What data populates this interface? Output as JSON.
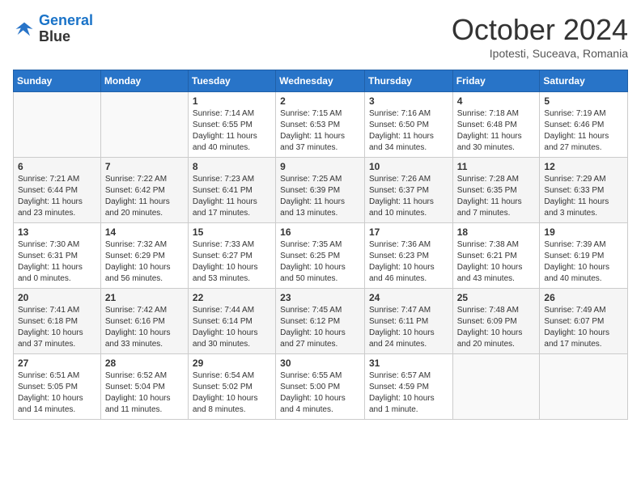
{
  "header": {
    "logo_line1": "General",
    "logo_line2": "Blue",
    "month": "October 2024",
    "location": "Ipotesti, Suceava, Romania"
  },
  "days_of_week": [
    "Sunday",
    "Monday",
    "Tuesday",
    "Wednesday",
    "Thursday",
    "Friday",
    "Saturday"
  ],
  "weeks": [
    [
      {
        "day": "",
        "info": ""
      },
      {
        "day": "",
        "info": ""
      },
      {
        "day": "1",
        "info": "Sunrise: 7:14 AM\nSunset: 6:55 PM\nDaylight: 11 hours and 40 minutes."
      },
      {
        "day": "2",
        "info": "Sunrise: 7:15 AM\nSunset: 6:53 PM\nDaylight: 11 hours and 37 minutes."
      },
      {
        "day": "3",
        "info": "Sunrise: 7:16 AM\nSunset: 6:50 PM\nDaylight: 11 hours and 34 minutes."
      },
      {
        "day": "4",
        "info": "Sunrise: 7:18 AM\nSunset: 6:48 PM\nDaylight: 11 hours and 30 minutes."
      },
      {
        "day": "5",
        "info": "Sunrise: 7:19 AM\nSunset: 6:46 PM\nDaylight: 11 hours and 27 minutes."
      }
    ],
    [
      {
        "day": "6",
        "info": "Sunrise: 7:21 AM\nSunset: 6:44 PM\nDaylight: 11 hours and 23 minutes."
      },
      {
        "day": "7",
        "info": "Sunrise: 7:22 AM\nSunset: 6:42 PM\nDaylight: 11 hours and 20 minutes."
      },
      {
        "day": "8",
        "info": "Sunrise: 7:23 AM\nSunset: 6:41 PM\nDaylight: 11 hours and 17 minutes."
      },
      {
        "day": "9",
        "info": "Sunrise: 7:25 AM\nSunset: 6:39 PM\nDaylight: 11 hours and 13 minutes."
      },
      {
        "day": "10",
        "info": "Sunrise: 7:26 AM\nSunset: 6:37 PM\nDaylight: 11 hours and 10 minutes."
      },
      {
        "day": "11",
        "info": "Sunrise: 7:28 AM\nSunset: 6:35 PM\nDaylight: 11 hours and 7 minutes."
      },
      {
        "day": "12",
        "info": "Sunrise: 7:29 AM\nSunset: 6:33 PM\nDaylight: 11 hours and 3 minutes."
      }
    ],
    [
      {
        "day": "13",
        "info": "Sunrise: 7:30 AM\nSunset: 6:31 PM\nDaylight: 11 hours and 0 minutes."
      },
      {
        "day": "14",
        "info": "Sunrise: 7:32 AM\nSunset: 6:29 PM\nDaylight: 10 hours and 56 minutes."
      },
      {
        "day": "15",
        "info": "Sunrise: 7:33 AM\nSunset: 6:27 PM\nDaylight: 10 hours and 53 minutes."
      },
      {
        "day": "16",
        "info": "Sunrise: 7:35 AM\nSunset: 6:25 PM\nDaylight: 10 hours and 50 minutes."
      },
      {
        "day": "17",
        "info": "Sunrise: 7:36 AM\nSunset: 6:23 PM\nDaylight: 10 hours and 46 minutes."
      },
      {
        "day": "18",
        "info": "Sunrise: 7:38 AM\nSunset: 6:21 PM\nDaylight: 10 hours and 43 minutes."
      },
      {
        "day": "19",
        "info": "Sunrise: 7:39 AM\nSunset: 6:19 PM\nDaylight: 10 hours and 40 minutes."
      }
    ],
    [
      {
        "day": "20",
        "info": "Sunrise: 7:41 AM\nSunset: 6:18 PM\nDaylight: 10 hours and 37 minutes."
      },
      {
        "day": "21",
        "info": "Sunrise: 7:42 AM\nSunset: 6:16 PM\nDaylight: 10 hours and 33 minutes."
      },
      {
        "day": "22",
        "info": "Sunrise: 7:44 AM\nSunset: 6:14 PM\nDaylight: 10 hours and 30 minutes."
      },
      {
        "day": "23",
        "info": "Sunrise: 7:45 AM\nSunset: 6:12 PM\nDaylight: 10 hours and 27 minutes."
      },
      {
        "day": "24",
        "info": "Sunrise: 7:47 AM\nSunset: 6:11 PM\nDaylight: 10 hours and 24 minutes."
      },
      {
        "day": "25",
        "info": "Sunrise: 7:48 AM\nSunset: 6:09 PM\nDaylight: 10 hours and 20 minutes."
      },
      {
        "day": "26",
        "info": "Sunrise: 7:49 AM\nSunset: 6:07 PM\nDaylight: 10 hours and 17 minutes."
      }
    ],
    [
      {
        "day": "27",
        "info": "Sunrise: 6:51 AM\nSunset: 5:05 PM\nDaylight: 10 hours and 14 minutes."
      },
      {
        "day": "28",
        "info": "Sunrise: 6:52 AM\nSunset: 5:04 PM\nDaylight: 10 hours and 11 minutes."
      },
      {
        "day": "29",
        "info": "Sunrise: 6:54 AM\nSunset: 5:02 PM\nDaylight: 10 hours and 8 minutes."
      },
      {
        "day": "30",
        "info": "Sunrise: 6:55 AM\nSunset: 5:00 PM\nDaylight: 10 hours and 4 minutes."
      },
      {
        "day": "31",
        "info": "Sunrise: 6:57 AM\nSunset: 4:59 PM\nDaylight: 10 hours and 1 minute."
      },
      {
        "day": "",
        "info": ""
      },
      {
        "day": "",
        "info": ""
      }
    ]
  ]
}
